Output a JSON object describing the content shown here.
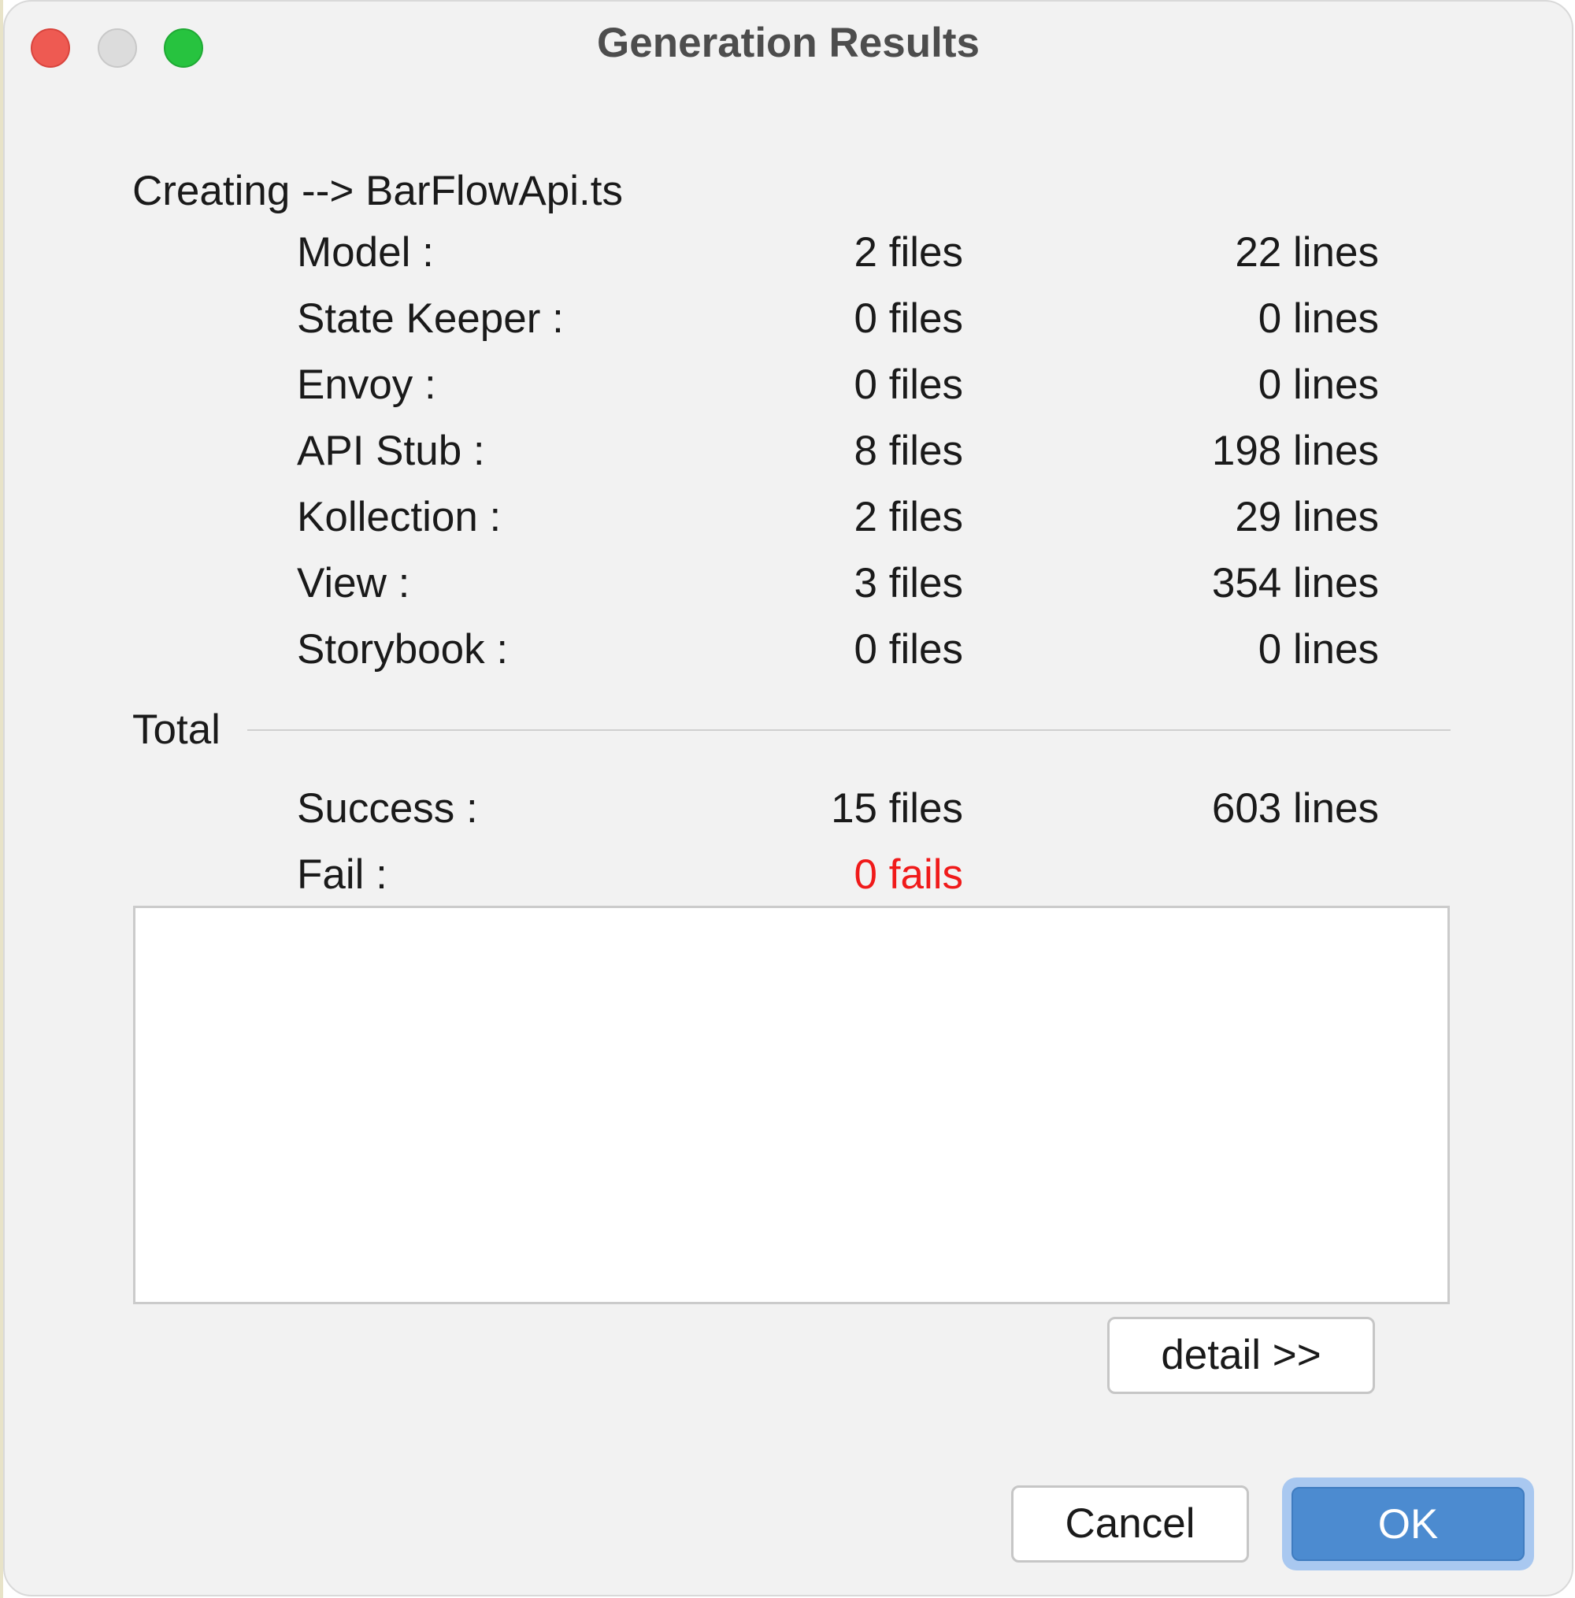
{
  "window": {
    "title": "Generation Results"
  },
  "creating_text": "Creating --> BarFlowApi.ts",
  "rows": [
    {
      "label": "Model :",
      "files": "2 files",
      "lines": "22 lines"
    },
    {
      "label": "State Keeper :",
      "files": "0 files",
      "lines": "0 lines"
    },
    {
      "label": "Envoy :",
      "files": "0 files",
      "lines": "0 lines"
    },
    {
      "label": "API Stub :",
      "files": "8 files",
      "lines": "198 lines"
    },
    {
      "label": "Kollection :",
      "files": "2 files",
      "lines": "29 lines"
    },
    {
      "label": "View :",
      "files": "3 files",
      "lines": "354 lines"
    },
    {
      "label": "Storybook :",
      "files": "0 files",
      "lines": "0 lines"
    }
  ],
  "total": {
    "label": "Total",
    "success": {
      "label": "Success :",
      "files": "15 files",
      "lines": "603 lines"
    },
    "fail": {
      "label": "Fail :",
      "value": "0 fails"
    }
  },
  "buttons": {
    "detail": "detail >>",
    "cancel": "Cancel",
    "ok": "OK"
  },
  "colors": {
    "fail_text": "#f01a1a",
    "ok_button": "#4c8bd0",
    "close_button": "#ee5a52",
    "maximize_button": "#27c33f"
  }
}
